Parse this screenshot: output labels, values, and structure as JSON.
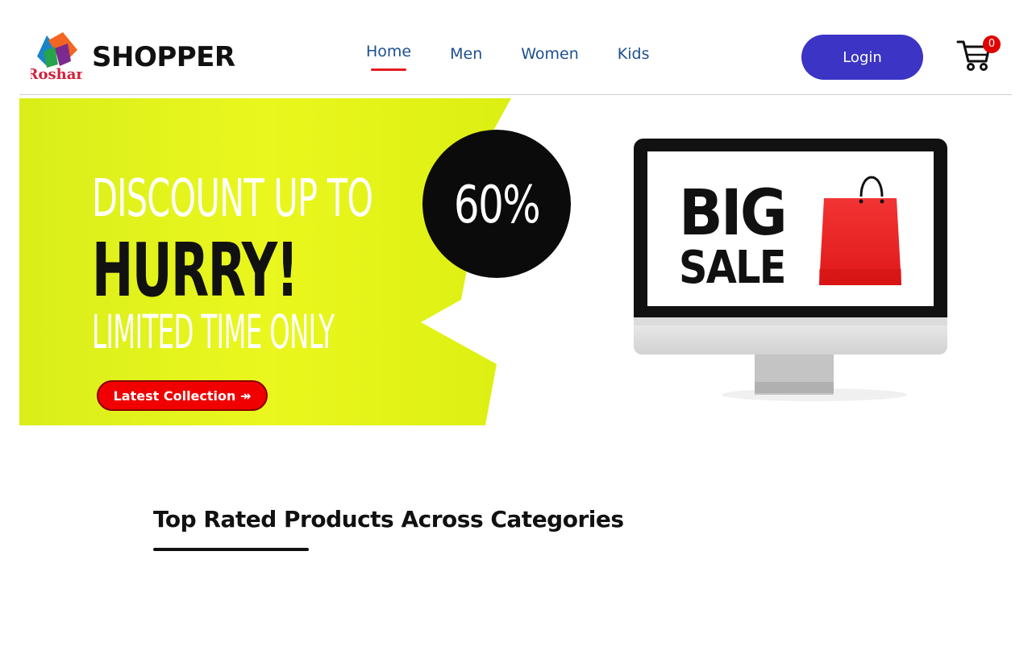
{
  "header": {
    "logo_text": "Roshan",
    "brand_name": "SHOPPER",
    "nav": [
      {
        "label": "Home",
        "active": true
      },
      {
        "label": "Men",
        "active": false
      },
      {
        "label": "Women",
        "active": false
      },
      {
        "label": "Kids",
        "active": false
      }
    ],
    "login_label": "Login",
    "cart_count": "0",
    "cart_icon": "shopping-cart-icon"
  },
  "hero": {
    "line1": "DISCOUNT UP TO",
    "line2": "HURRY!",
    "line3": "LIMITED TIME ONLY",
    "badge": "60%",
    "cta_label": "Latest Collection ↠",
    "monitor_big": "BIG",
    "monitor_sale": "SALE",
    "bag_icon": "shopping-bag-icon",
    "colors": {
      "banner": "#e6f516",
      "badge": "#0b0b0b",
      "cta": "#f00000",
      "bag": "#ee2a2a"
    }
  },
  "section": {
    "title": "Top Rated Products Across Categories"
  },
  "colors": {
    "nav_text": "#1d4f91",
    "nav_active_underline": "#e51b23",
    "login_button": "#3b34c4",
    "cart_badge": "#e00000"
  }
}
